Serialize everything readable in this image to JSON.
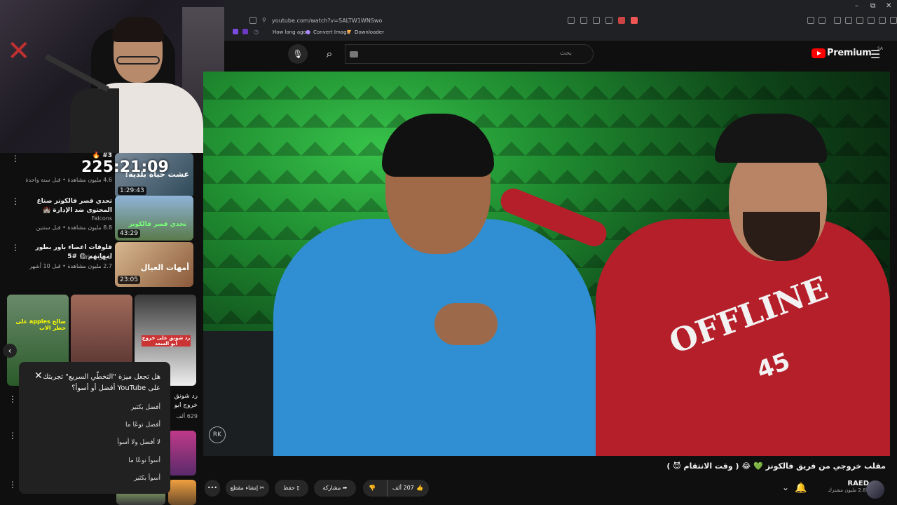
{
  "browser": {
    "url": "youtube.com/watch?v=SALTW1WNSwo",
    "bookmarks": [
      "How long ago",
      "Convert Image",
      "Downloader"
    ],
    "window_controls": [
      "–",
      "⧉",
      "✕"
    ]
  },
  "header": {
    "search_placeholder": "بحث",
    "logo_text": "Premium",
    "country_code": "SA"
  },
  "overlay_timer": "225:21:09",
  "recommended": [
    {
      "title": "#3 🔥",
      "channel": "",
      "meta": "4.6 مليون مشاهدة • قبل سنة واحدة",
      "duration": "1:29:43",
      "thumb_text": "عشت حياة بلدية!"
    },
    {
      "title": "تحدي قصر فالكونز صناع المحتوى ضد الإدارة 🏰",
      "channel": "Falcons",
      "meta": "8.8 مليون مشاهدة • قبل سنتين",
      "duration": "43:29",
      "thumb_text": "تحدي قصر فالكونز"
    },
    {
      "title": "فلوقات اعضاء باور بطور امهاتهم 😍 #5",
      "channel": "فارس | Faris",
      "meta": "2.7 مليون مشاهدة • قبل 10 أشهر",
      "duration": "23:05",
      "thumb_text": "أمهات العيال"
    }
  ],
  "shorts": [
    {
      "text": "صالح apples على خطر الاب"
    },
    {
      "text": ""
    },
    {
      "text": "رد شونق على خروج ابو السعد"
    }
  ],
  "short_captions": {
    "title_partial": "رد شونق",
    "line2": "خروج ابو",
    "views": "629 ألف"
  },
  "survey": {
    "question": "هل تجعل ميزة \"التخطّي السريع\" تجربتك على YouTube أفضل أو أسوأ؟",
    "options": [
      "أفضل بكثير",
      "أفضل نوعًا ما",
      "لا أفضل ولا أسوأ",
      "أسوأ نوعًا ما",
      "أسوأ بكثير"
    ]
  },
  "video": {
    "title": "مقلب خروجي من فريق فالكونز 💚 😂 ( وقت الانتقام 😈 )",
    "jacket_text": "OFFLINE",
    "jacket_number": "45",
    "watermark": "RK"
  },
  "actions": {
    "clip": "إنشاء مقطع",
    "save": "حفظ",
    "share": "مشاركة",
    "likes": "207 ألف",
    "more": "•••"
  },
  "channel": {
    "name": "RAED",
    "subs": "2.81 مليون مشترك"
  }
}
